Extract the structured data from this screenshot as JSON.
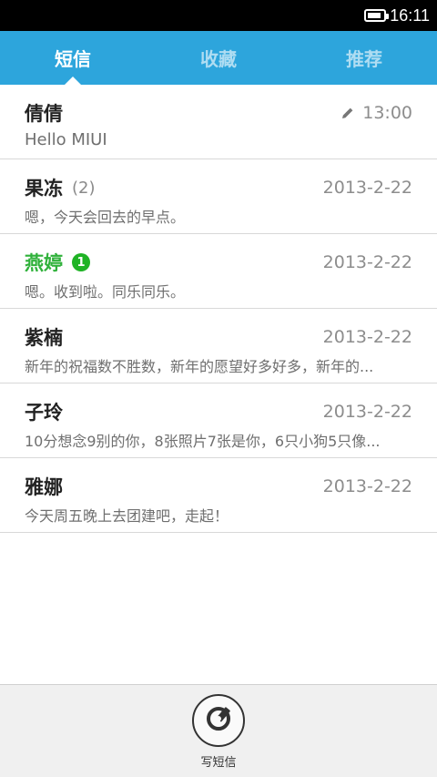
{
  "status_bar": {
    "time": "16:11",
    "battery_level": 0.9
  },
  "tabs": [
    {
      "label": "短信",
      "active": true
    },
    {
      "label": "收藏",
      "active": false
    },
    {
      "label": "推荐",
      "active": false
    }
  ],
  "conversations": [
    {
      "name": "倩倩",
      "count": "",
      "unread": "",
      "time": "13:00",
      "draft": true,
      "preview": "Hello MIUI"
    },
    {
      "name": "果冻",
      "count": "(2)",
      "unread": "",
      "time": "2013-2-22",
      "draft": false,
      "preview": "嗯，今天会回去的早点。"
    },
    {
      "name": "燕婷",
      "count": "",
      "unread": "1",
      "time": "2013-2-22",
      "draft": false,
      "preview": "嗯。收到啦。同乐同乐。"
    },
    {
      "name": "紫楠",
      "count": "",
      "unread": "",
      "time": "2013-2-22",
      "draft": false,
      "preview": "新年的祝福数不胜数，新年的愿望好多好多，新年的..."
    },
    {
      "name": "子玲",
      "count": "",
      "unread": "",
      "time": "2013-2-22",
      "draft": false,
      "preview": "10分想念9别的你，8张照片7张是你，6只小狗5只像..."
    },
    {
      "name": "雅娜",
      "count": "",
      "unread": "",
      "time": "2013-2-22",
      "draft": false,
      "preview": "今天周五晚上去团建吧，走起！"
    }
  ],
  "bottom": {
    "compose_label": "写短信",
    "compose_icon": "compose-icon"
  },
  "colors": {
    "tab_bar": "#2da5dc",
    "unread_name": "#2fb13a",
    "badge": "#1fb325"
  }
}
